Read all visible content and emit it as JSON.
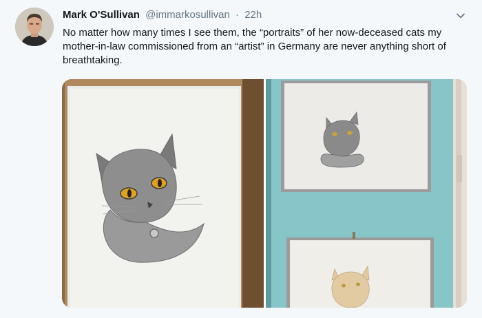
{
  "tweet": {
    "author_name": "Mark O'Sullivan",
    "author_handle": "@immarkosullivan",
    "separator": "·",
    "timestamp": "22h",
    "text": "No matter how many times I see them, the “portraits” of her now-deceased cats my mother-in-law commissioned from an “artist” in Germany are never anything short of breathtaking.",
    "menu_icon": "chevron-down-icon"
  },
  "media": {
    "photos": [
      {
        "name": "photo-left",
        "description_icon": "photo"
      },
      {
        "name": "photo-right",
        "description_icon": "photo"
      }
    ]
  },
  "colors": {
    "background": "#f5f8fa",
    "text": "#14171a",
    "secondary": "#657786",
    "wall": "#85c5c8"
  }
}
